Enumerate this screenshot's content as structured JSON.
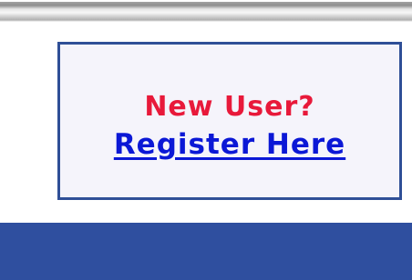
{
  "register_panel": {
    "prompt": "New User?",
    "link_label": "Register Here"
  },
  "colors": {
    "panel_border": "#2f4f97",
    "panel_background": "#f5f4fb",
    "prompt_text": "#e8193a",
    "link_text": "#0b18d6",
    "bottom_band": "#2f4f9f"
  }
}
